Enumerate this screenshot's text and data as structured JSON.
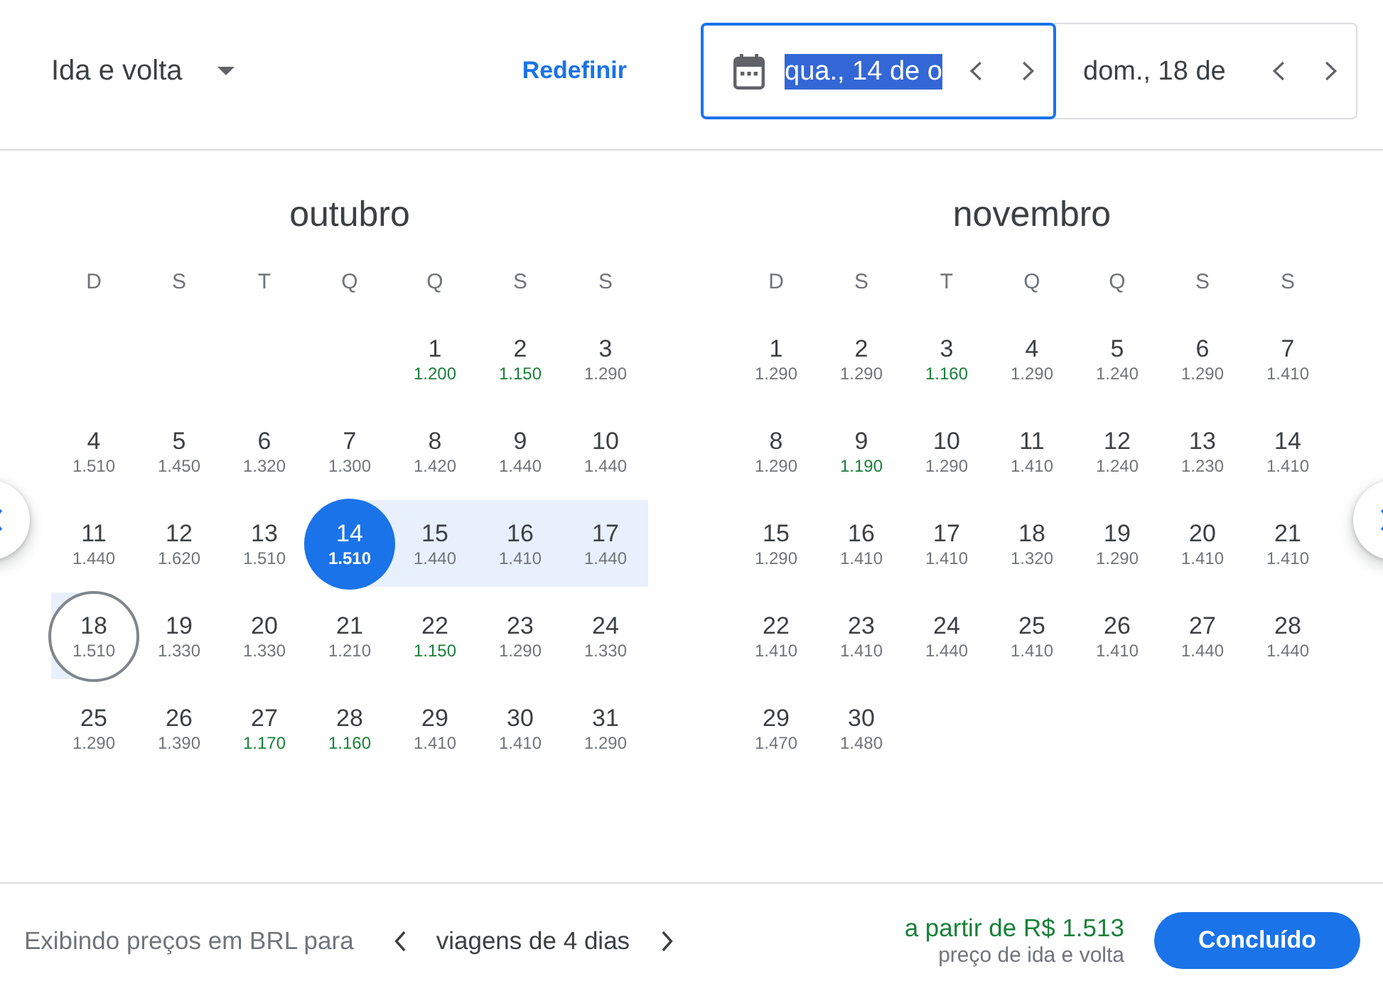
{
  "header": {
    "trip_type": "Ida e volta",
    "reset_button": "Redefinir",
    "date_fields": [
      {
        "kind": "departure",
        "value": "qua., 14 de o",
        "selected": true,
        "text_selected": true
      },
      {
        "kind": "return",
        "value": "dom., 18 de",
        "selected": false,
        "text_selected": false
      }
    ]
  },
  "months": [
    {
      "name": "outubro",
      "weekdays": [
        "D",
        "S",
        "T",
        "Q",
        "Q",
        "S",
        "S"
      ],
      "weeks": [
        [
          {
            "day": "1",
            "price": "1.200",
            "low_price": true,
            "selected": false
          },
          {
            "day": "2",
            "price": "1.150",
            "low_price": true,
            "selected": false
          },
          {
            "day": "3",
            "price": "1.290",
            "low_price": false,
            "selected": false
          }
        ],
        [
          {
            "day": "4",
            "price": "1.510",
            "low_price": false,
            "selected": false
          },
          {
            "day": "5",
            "price": "1.450",
            "low_price": false,
            "selected": false
          },
          {
            "day": "6",
            "price": "1.320",
            "low_price": false,
            "selected": false
          },
          {
            "day": "7",
            "price": "1.300",
            "low_price": false,
            "selected": false
          },
          {
            "day": "8",
            "price": "1.420",
            "low_price": false,
            "selected": false
          },
          {
            "day": "9",
            "price": "1.440",
            "low_price": false,
            "selected": false
          },
          {
            "day": "10",
            "price": "1.440",
            "low_price": false,
            "selected": false
          }
        ],
        [
          {
            "day": "11",
            "price": "1.440",
            "low_price": false,
            "selected": false
          },
          {
            "day": "12",
            "price": "1.620",
            "low_price": false,
            "selected": false
          },
          {
            "day": "13",
            "price": "1.510",
            "low_price": false,
            "selected": false
          },
          {
            "day": "14",
            "price": "1.510",
            "low_price": false,
            "selected": true
          },
          {
            "day": "15",
            "price": "1.440",
            "low_price": false,
            "selected": false
          },
          {
            "day": "16",
            "price": "1.410",
            "low_price": false,
            "selected": false
          },
          {
            "day": "17",
            "price": "1.440",
            "low_price": false,
            "selected": false
          }
        ],
        [
          {
            "day": "18",
            "price": "1.510",
            "low_price": false,
            "selected": true
          },
          {
            "day": "19",
            "price": "1.330",
            "low_price": false,
            "selected": false
          },
          {
            "day": "20",
            "price": "1.330",
            "low_price": false,
            "selected": false
          },
          {
            "day": "21",
            "price": "1.210",
            "low_price": false,
            "selected": false
          },
          {
            "day": "22",
            "price": "1.150",
            "low_price": true,
            "selected": false
          },
          {
            "day": "23",
            "price": "1.290",
            "low_price": false,
            "selected": false
          },
          {
            "day": "24",
            "price": "1.330",
            "low_price": false,
            "selected": false
          }
        ],
        [
          {
            "day": "25",
            "price": "1.290",
            "low_price": false,
            "selected": false
          },
          {
            "day": "26",
            "price": "1.390",
            "low_price": false,
            "selected": false
          },
          {
            "day": "27",
            "price": "1.170",
            "low_price": true,
            "selected": false
          },
          {
            "day": "28",
            "price": "1.160",
            "low_price": true,
            "selected": false
          },
          {
            "day": "29",
            "price": "1.410",
            "low_price": false,
            "selected": false
          },
          {
            "day": "30",
            "price": "1.410",
            "low_price": false,
            "selected": false
          },
          {
            "day": "31",
            "price": "1.290",
            "low_price": false,
            "selected": false
          }
        ]
      ]
    },
    {
      "name": "novembro",
      "weekdays": [
        "D",
        "S",
        "T",
        "Q",
        "Q",
        "S",
        "S"
      ],
      "weeks": [
        [
          {
            "day": "1",
            "price": "1.290",
            "low_price": false,
            "selected": false
          },
          {
            "day": "2",
            "price": "1.290",
            "low_price": false,
            "selected": false
          },
          {
            "day": "3",
            "price": "1.160",
            "low_price": true,
            "selected": false
          },
          {
            "day": "4",
            "price": "1.290",
            "low_price": false,
            "selected": false
          },
          {
            "day": "5",
            "price": "1.240",
            "low_price": false,
            "selected": false
          },
          {
            "day": "6",
            "price": "1.290",
            "low_price": false,
            "selected": false
          },
          {
            "day": "7",
            "price": "1.410",
            "low_price": false,
            "selected": false
          }
        ],
        [
          {
            "day": "8",
            "price": "1.290",
            "low_price": false,
            "selected": false
          },
          {
            "day": "9",
            "price": "1.190",
            "low_price": true,
            "selected": false
          },
          {
            "day": "10",
            "price": "1.290",
            "low_price": false,
            "selected": false
          },
          {
            "day": "11",
            "price": "1.410",
            "low_price": false,
            "selected": false
          },
          {
            "day": "12",
            "price": "1.240",
            "low_price": false,
            "selected": false
          },
          {
            "day": "13",
            "price": "1.230",
            "low_price": false,
            "selected": false
          },
          {
            "day": "14",
            "price": "1.410",
            "low_price": false,
            "selected": false
          }
        ],
        [
          {
            "day": "15",
            "price": "1.290",
            "low_price": false,
            "selected": false
          },
          {
            "day": "16",
            "price": "1.410",
            "low_price": false,
            "selected": false
          },
          {
            "day": "17",
            "price": "1.410",
            "low_price": false,
            "selected": false
          },
          {
            "day": "18",
            "price": "1.320",
            "low_price": false,
            "selected": false
          },
          {
            "day": "19",
            "price": "1.290",
            "low_price": false,
            "selected": false
          },
          {
            "day": "20",
            "price": "1.410",
            "low_price": false,
            "selected": false
          },
          {
            "day": "21",
            "price": "1.410",
            "low_price": false,
            "selected": false
          }
        ],
        [
          {
            "day": "22",
            "price": "1.410",
            "low_price": false,
            "selected": false
          },
          {
            "day": "23",
            "price": "1.410",
            "low_price": false,
            "selected": false
          },
          {
            "day": "24",
            "price": "1.440",
            "low_price": false,
            "selected": false
          },
          {
            "day": "25",
            "price": "1.410",
            "low_price": false,
            "selected": false
          },
          {
            "day": "26",
            "price": "1.410",
            "low_price": false,
            "selected": false
          },
          {
            "day": "27",
            "price": "1.440",
            "low_price": false,
            "selected": false
          },
          {
            "day": "28",
            "price": "1.440",
            "low_price": false,
            "selected": false
          }
        ],
        [
          {
            "day": "29",
            "price": "1.470",
            "low_price": false,
            "selected": false
          },
          {
            "day": "30",
            "price": "1.480",
            "low_price": false,
            "selected": false
          }
        ]
      ]
    }
  ],
  "footer": {
    "currency_note": "Exibindo preços em BRL para",
    "trip_length": "viagens de 4 dias",
    "price_from": "a partir de R$ 1.513",
    "price_note": "preço de ida e volta",
    "done_button": "Concluído"
  }
}
